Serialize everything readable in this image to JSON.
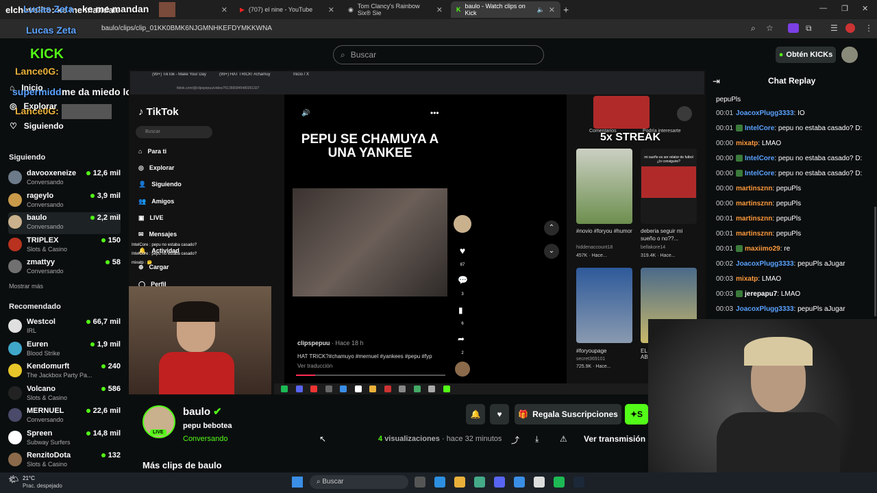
{
  "browser": {
    "tabs": [
      {
        "label": "elchevelito: ke me mandan",
        "active": false
      },
      {
        "label": "(707) el nine - YouTube",
        "active": false
      },
      {
        "label": "Tom Clancy's Rainbow Six® Sie",
        "active": false
      },
      {
        "label": "baulo - Watch clips on Kick",
        "active": true
      }
    ],
    "url": "baulo/clips/clip_01KK0BMK6NJGMNHKEFDYMKKWNA"
  },
  "overlays": {
    "chat1_user": "Lucas Zeta",
    "kick_logo": "KICK",
    "chat2_user": "Lucas Zeta",
    "chat3_user": "Lance0G:",
    "chat4_user": "supermidd:",
    "chat4_msg": "me da miedo los links amio",
    "chat5_user": "Lance0G:",
    "chat_top_msg": "ke me mandan"
  },
  "header": {
    "search_placeholder": "Buscar",
    "get_kicks": "Obtén KICKs"
  },
  "nav": {
    "inicio": "Inicio",
    "explorar": "Explorar",
    "siguiendo": "Siguiendo"
  },
  "sidebar": {
    "following_header": "Siguiendo",
    "following": [
      {
        "name": "davooxeneize",
        "sub": "Conversando",
        "viewers": "12,6 mil",
        "color": "#6c7a8a"
      },
      {
        "name": "rageylo",
        "sub": "Conversando",
        "viewers": "3,9 mil",
        "color": "#c99a4a"
      },
      {
        "name": "baulo",
        "sub": "Conversando",
        "viewers": "2,2 mil",
        "color": "#c9b18d"
      },
      {
        "name": "TRIPLEX",
        "sub": "Slots & Casino",
        "viewers": "150",
        "color": "#b8321f"
      },
      {
        "name": "zmattyy",
        "sub": "Conversando",
        "viewers": "58",
        "color": "#707070"
      }
    ],
    "show_more": "Mostrar más",
    "recommended_header": "Recomendado",
    "recommended": [
      {
        "name": "Westcol",
        "sub": "IRL",
        "viewers": "66,7 mil",
        "color": "#e0e0e0"
      },
      {
        "name": "Euren",
        "sub": "Blood Strike",
        "viewers": "1,9 mil",
        "color": "#3fa7c9"
      },
      {
        "name": "Kendomurft",
        "sub": "The Jackbox Party Pa...",
        "viewers": "240",
        "color": "#e8c62a"
      },
      {
        "name": "Volcano",
        "sub": "Slots & Casino",
        "viewers": "586",
        "color": "#222222"
      },
      {
        "name": "MERNUEL",
        "sub": "Conversando",
        "viewers": "22,6 mil",
        "color": "#4a4a6a"
      },
      {
        "name": "Spreen",
        "sub": "Subway Surfers",
        "viewers": "14,8 mil",
        "color": "#ffffff"
      },
      {
        "name": "RenzitoDota",
        "sub": "Slots & Casino",
        "viewers": "132",
        "color": "#8a6a4a"
      }
    ]
  },
  "tiktok": {
    "inner_tabs": [
      "(99+) TikTok - Make Your Day",
      "(99+) HAT TRICK! #chamuy",
      "Inicio / X"
    ],
    "inner_url": "tiktok.com/@clipspepuu/video/7613665845480261327",
    "logo": "TikTok",
    "search": "Buscar",
    "menu": [
      "Para ti",
      "Explorar",
      "Siguiendo",
      "Amigos",
      "LIVE",
      "Mensajes",
      "Actividad",
      "Cargar",
      "Perfil"
    ],
    "mini_chat": [
      "IntelCore : pepu no estaba casado?",
      "IntelCore : pepu no estaba casado?",
      "mixatp : 🤔"
    ],
    "video_title": "PEPU SE CHAMUYA A UNA YANKEE",
    "author": "clipspepuu",
    "posted": "· Hace 18 h",
    "caption": "HAT TRICK?#chamuyo #mernuel #yankees #pepu #fyp",
    "translate": "Ver traducción",
    "counts": {
      "likes": "87",
      "comments": "3",
      "saves": "6",
      "shares": "2"
    },
    "right_tabs": [
      "Comentarios",
      "Podría interesarte"
    ],
    "streak": "5x STREAK",
    "suggestions": [
      {
        "title": "#novio #foryou #humor",
        "author": "hiddenaccount18",
        "views": "457K",
        "age": "Hace..."
      },
      {
        "title": "deberia seguir mi sueño o no??...",
        "author": "bellakore14",
        "views": "319.4K",
        "age": "Hace..."
      },
      {
        "title": "#foryoupage",
        "author": "secret369101",
        "views": "725.9K",
        "age": "Hace..."
      },
      {
        "title": "EL AB",
        "author": "",
        "views": "",
        "age": ""
      }
    ],
    "thumb_text": "mi sueño es ser relator de futbol ¿lo consiguire?"
  },
  "clip_info": {
    "streamer": "baulo",
    "title": "pepu bebotea",
    "category": "Conversando",
    "live_badge": "LIVE",
    "views_count": "4",
    "views_label": "visualizaciones",
    "time": "· hace 32 minutos",
    "gift_subs": "Regala Suscripciones",
    "follow_partial": "S",
    "watch_stream": "Ver transmisión",
    "more_clips": "Más clips de baulo"
  },
  "chat": {
    "title": "Chat Replay",
    "top_msg": "pepuPls",
    "messages": [
      {
        "time": "00:01",
        "user": "JoacoxPlugg3333",
        "color": "#5aa2ff",
        "msg": ": IO"
      },
      {
        "time": "00:01",
        "user": "IntelCore",
        "color": "#5aa2ff",
        "msg": ": pepu no estaba casado? D:"
      },
      {
        "time": "00:00",
        "user": "mixatp",
        "color": "#ff9a3c",
        "msg": ": LMAO"
      },
      {
        "time": "00:00",
        "user": "IntelCore",
        "color": "#5aa2ff",
        "msg": ": pepu no estaba casado? D:"
      },
      {
        "time": "00:00",
        "user": "IntelCore",
        "color": "#5aa2ff",
        "msg": ": pepu no estaba casado? D:"
      },
      {
        "time": "00:00",
        "user": "martinsznn",
        "color": "#ff9a3c",
        "msg": ": pepuPls"
      },
      {
        "time": "00:00",
        "user": "martinsznn",
        "color": "#ff9a3c",
        "msg": ": pepuPls"
      },
      {
        "time": "00:01",
        "user": "martinsznn",
        "color": "#ff9a3c",
        "msg": ": pepuPls"
      },
      {
        "time": "00:01",
        "user": "martinsznn",
        "color": "#ff9a3c",
        "msg": ": pepuPls"
      },
      {
        "time": "00:01",
        "user": "maxiimo29",
        "color": "#ff9a3c",
        "msg": ": re"
      },
      {
        "time": "00:02",
        "user": "JoacoxPlugg3333",
        "color": "#5aa2ff",
        "msg": ": pepuPls aJugar"
      },
      {
        "time": "00:03",
        "user": "mixatp",
        "color": "#ff9a3c",
        "msg": ": LMAO"
      },
      {
        "time": "00:03",
        "user": "jerepapu7",
        "color": "#ffffff",
        "msg": ": LMAO"
      },
      {
        "time": "00:03",
        "user": "JoacoxPlugg3333",
        "color": "#5aa2ff",
        "msg": ": pepuPls aJugar"
      }
    ]
  },
  "taskbar": {
    "weather_temp": "21°C",
    "weather_desc": "Prac. despejado",
    "search": "Buscar"
  },
  "colors": {
    "kick_green": "#53fc18",
    "chat_blue": "#5aa2ff",
    "chat_orange": "#ff9a3c"
  }
}
